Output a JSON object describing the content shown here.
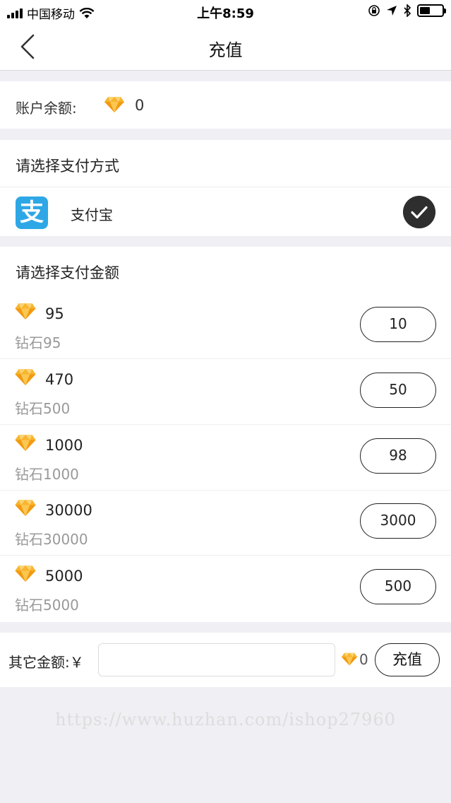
{
  "status_bar": {
    "carrier": "中国移动",
    "time": "上午8:59",
    "battery_level": 0.45
  },
  "nav": {
    "title": "充值",
    "back_icon": "chevron-left-icon"
  },
  "balance": {
    "label": "账户余额:",
    "value": "0",
    "icon": "diamond-icon"
  },
  "payment_method": {
    "heading": "请选择支付方式",
    "option": {
      "logo_char": "支",
      "label": "支付宝",
      "selected": true,
      "logo_color": "#2ea7e6"
    }
  },
  "amounts": {
    "heading": "请选择支付金额",
    "items": [
      {
        "diamonds": "95",
        "desc": "钻石95",
        "price": "10"
      },
      {
        "diamonds": "470",
        "desc": "钻石500",
        "price": "50"
      },
      {
        "diamonds": "1000",
        "desc": "钻石1000",
        "price": "98"
      },
      {
        "diamonds": "30000",
        "desc": "钻石30000",
        "price": "3000"
      },
      {
        "diamonds": "5000",
        "desc": "钻石5000",
        "price": "500"
      }
    ]
  },
  "other": {
    "label": "其它金额:￥",
    "input_value": "",
    "diamond_value": "0",
    "button_label": "充值"
  },
  "watermark": "https://www.huzhan.com/ishop27960",
  "colors": {
    "diamond": "#f5a623",
    "background": "#efeff4",
    "check_bg": "#2e2e2e"
  }
}
